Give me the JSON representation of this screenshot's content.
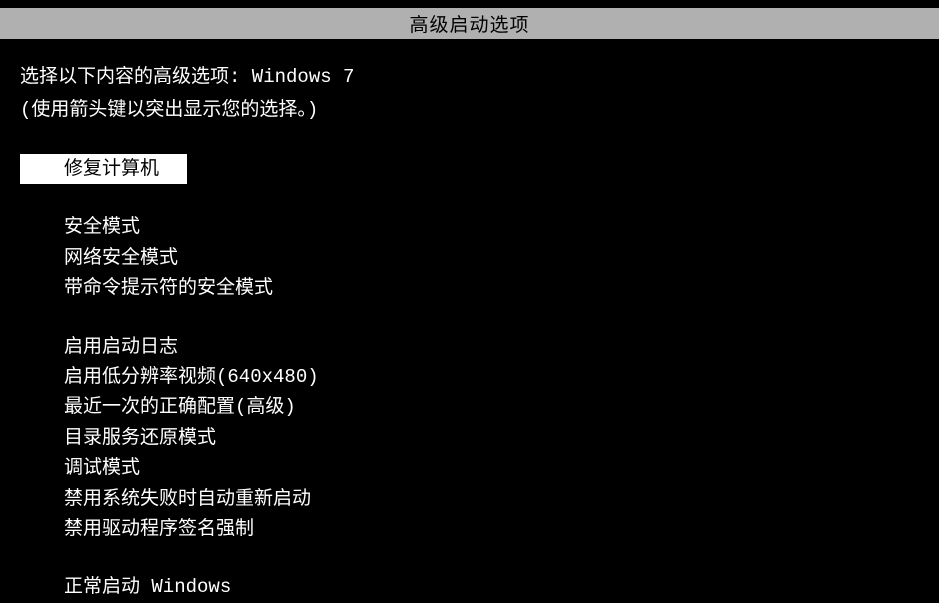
{
  "title": "高级启动选项",
  "prompt_line1": "选择以下内容的高级选项: Windows 7",
  "prompt_line2": "(使用箭头键以突出显示您的选择。)",
  "options": {
    "repair": "修复计算机",
    "safe_mode": "安全模式",
    "safe_mode_net": "网络安全模式",
    "safe_mode_cmd": "带命令提示符的安全模式",
    "boot_log": "启用启动日志",
    "low_res": "启用低分辨率视频(640x480)",
    "last_known": "最近一次的正确配置(高级)",
    "ds_restore": "目录服务还原模式",
    "debug": "调试模式",
    "disable_auto_restart": "禁用系统失败时自动重新启动",
    "disable_driver_sig": "禁用驱动程序签名强制",
    "normal_start": "正常启动 Windows"
  }
}
